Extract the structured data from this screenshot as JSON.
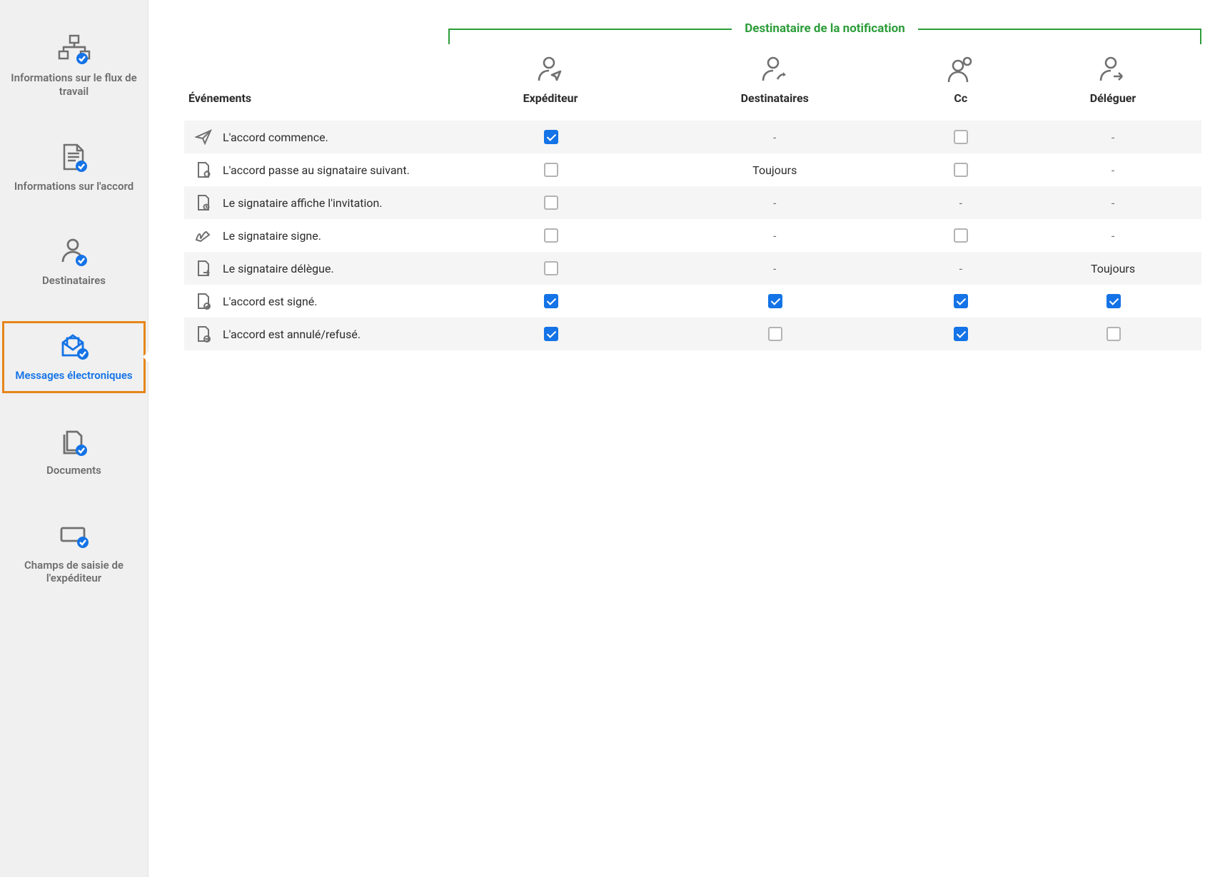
{
  "sidebar": {
    "items": [
      {
        "id": "workflow-info",
        "label": "Informations sur le flux de travail",
        "active": false
      },
      {
        "id": "agreement-info",
        "label": "Informations sur l'accord",
        "active": false
      },
      {
        "id": "recipients",
        "label": "Destinataires",
        "active": false
      },
      {
        "id": "emails",
        "label": "Messages électroniques",
        "active": true
      },
      {
        "id": "documents",
        "label": "Documents",
        "active": false
      },
      {
        "id": "sender-fields",
        "label": "Champs de saisie de l'expéditeur",
        "active": false
      }
    ]
  },
  "table": {
    "group_header": "Destinataire de la notification",
    "events_header": "Événements",
    "columns": [
      {
        "id": "sender",
        "label": "Expéditeur"
      },
      {
        "id": "recipients",
        "label": "Destinataires"
      },
      {
        "id": "cc",
        "label": "Cc"
      },
      {
        "id": "delegate",
        "label": "Déléguer"
      }
    ],
    "rows": [
      {
        "icon": "send",
        "label": "L'accord commence.",
        "cells": [
          {
            "type": "checkbox",
            "checked": true
          },
          {
            "type": "text",
            "value": "-"
          },
          {
            "type": "checkbox",
            "checked": false
          },
          {
            "type": "text",
            "value": "-"
          }
        ]
      },
      {
        "icon": "next-signer",
        "label": "L'accord passe au signataire suivant.",
        "cells": [
          {
            "type": "checkbox",
            "checked": false
          },
          {
            "type": "text",
            "value": "Toujours"
          },
          {
            "type": "checkbox",
            "checked": false
          },
          {
            "type": "text",
            "value": "-"
          }
        ]
      },
      {
        "icon": "view",
        "label": "Le signataire affiche l'invitation.",
        "cells": [
          {
            "type": "checkbox",
            "checked": false
          },
          {
            "type": "text",
            "value": "-"
          },
          {
            "type": "text",
            "value": "-"
          },
          {
            "type": "text",
            "value": "-"
          }
        ]
      },
      {
        "icon": "sign",
        "label": "Le signataire signe.",
        "cells": [
          {
            "type": "checkbox",
            "checked": false
          },
          {
            "type": "text",
            "value": "-"
          },
          {
            "type": "checkbox",
            "checked": false
          },
          {
            "type": "text",
            "value": "-"
          }
        ]
      },
      {
        "icon": "delegate",
        "label": "Le signataire délègue.",
        "cells": [
          {
            "type": "checkbox",
            "checked": false
          },
          {
            "type": "text",
            "value": "-"
          },
          {
            "type": "text",
            "value": "-"
          },
          {
            "type": "text",
            "value": "Toujours"
          }
        ]
      },
      {
        "icon": "signed",
        "label": "L'accord est signé.",
        "cells": [
          {
            "type": "checkbox",
            "checked": true
          },
          {
            "type": "checkbox",
            "checked": true
          },
          {
            "type": "checkbox",
            "checked": true
          },
          {
            "type": "checkbox",
            "checked": true
          }
        ]
      },
      {
        "icon": "cancelled",
        "label": "L'accord est annulé/refusé.",
        "cells": [
          {
            "type": "checkbox",
            "checked": true
          },
          {
            "type": "checkbox",
            "checked": false
          },
          {
            "type": "checkbox",
            "checked": true
          },
          {
            "type": "checkbox",
            "checked": false
          }
        ]
      }
    ]
  }
}
